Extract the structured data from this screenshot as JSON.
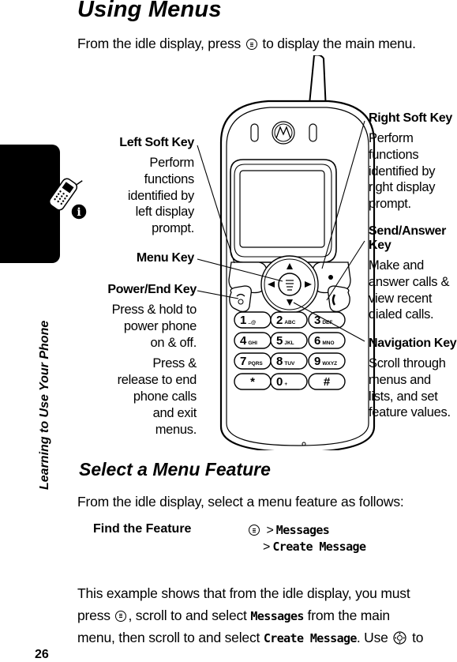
{
  "section": {
    "title": "Using Menus",
    "intro_before": "From the idle display, press",
    "intro_icon": "menu-key-icon",
    "intro_after": "to display the main menu."
  },
  "side_tab": {
    "label": "Learning to Use Your Phone",
    "icon": "phone-info-icon"
  },
  "diagram": {
    "callouts": {
      "left_soft_key": {
        "title": "Left Soft Key",
        "lines": [
          "Perform",
          "functions",
          "identified by",
          "left display",
          "prompt."
        ]
      },
      "menu_key": {
        "title": "Menu Key"
      },
      "power_end_key": {
        "title": "Power/End Key",
        "lines": [
          "Press & hold to",
          "power phone",
          "on & off."
        ],
        "lines2": [
          "Press &",
          "release to end",
          "phone calls",
          "and exit",
          "menus."
        ]
      },
      "right_soft_key": {
        "title": "Right Soft Key",
        "lines": [
          "Perform",
          "functions",
          "identified by",
          "right display",
          "prompt."
        ]
      },
      "send_answer_key": {
        "title_lines": [
          "Send/Answer",
          "Key"
        ],
        "lines": [
          "Make and",
          "answer calls &",
          "view recent",
          "dialed calls."
        ]
      },
      "navigation_key": {
        "title": "Navigation Key",
        "lines": [
          "Scroll through",
          "menus and",
          "lists, and set",
          "feature values."
        ]
      }
    },
    "keypad": [
      [
        "1",
        "..@"
      ],
      [
        "2",
        "ABC"
      ],
      [
        "3",
        "DEF"
      ],
      [
        "4",
        "GHI"
      ],
      [
        "5",
        "JKL"
      ],
      [
        "6",
        "MNO"
      ],
      [
        "7",
        "PQRS"
      ],
      [
        "8",
        "TUV"
      ],
      [
        "9",
        "WXYZ"
      ],
      [
        "*",
        ""
      ],
      [
        "0",
        "+"
      ],
      [
        "#",
        ""
      ]
    ]
  },
  "subsection": {
    "title": "Select a Menu Feature",
    "intro": "From the idle display, select a menu feature as follows:",
    "find_label": "Find the Feature",
    "path": [
      {
        "sep": ">",
        "item": "Messages"
      },
      {
        "sep": ">",
        "item": "Create Message"
      }
    ]
  },
  "example": {
    "line1": "This example shows that from the idle display, you must",
    "line2_a": "press",
    "line2_b": ", scroll to and select",
    "line2_code": "Messages",
    "line2_c": "from the main",
    "line3_a": "menu, then scroll to and select",
    "line3_code": "Create Message",
    "line3_b": ". Use",
    "line3_c": "to"
  },
  "page_number": "26"
}
